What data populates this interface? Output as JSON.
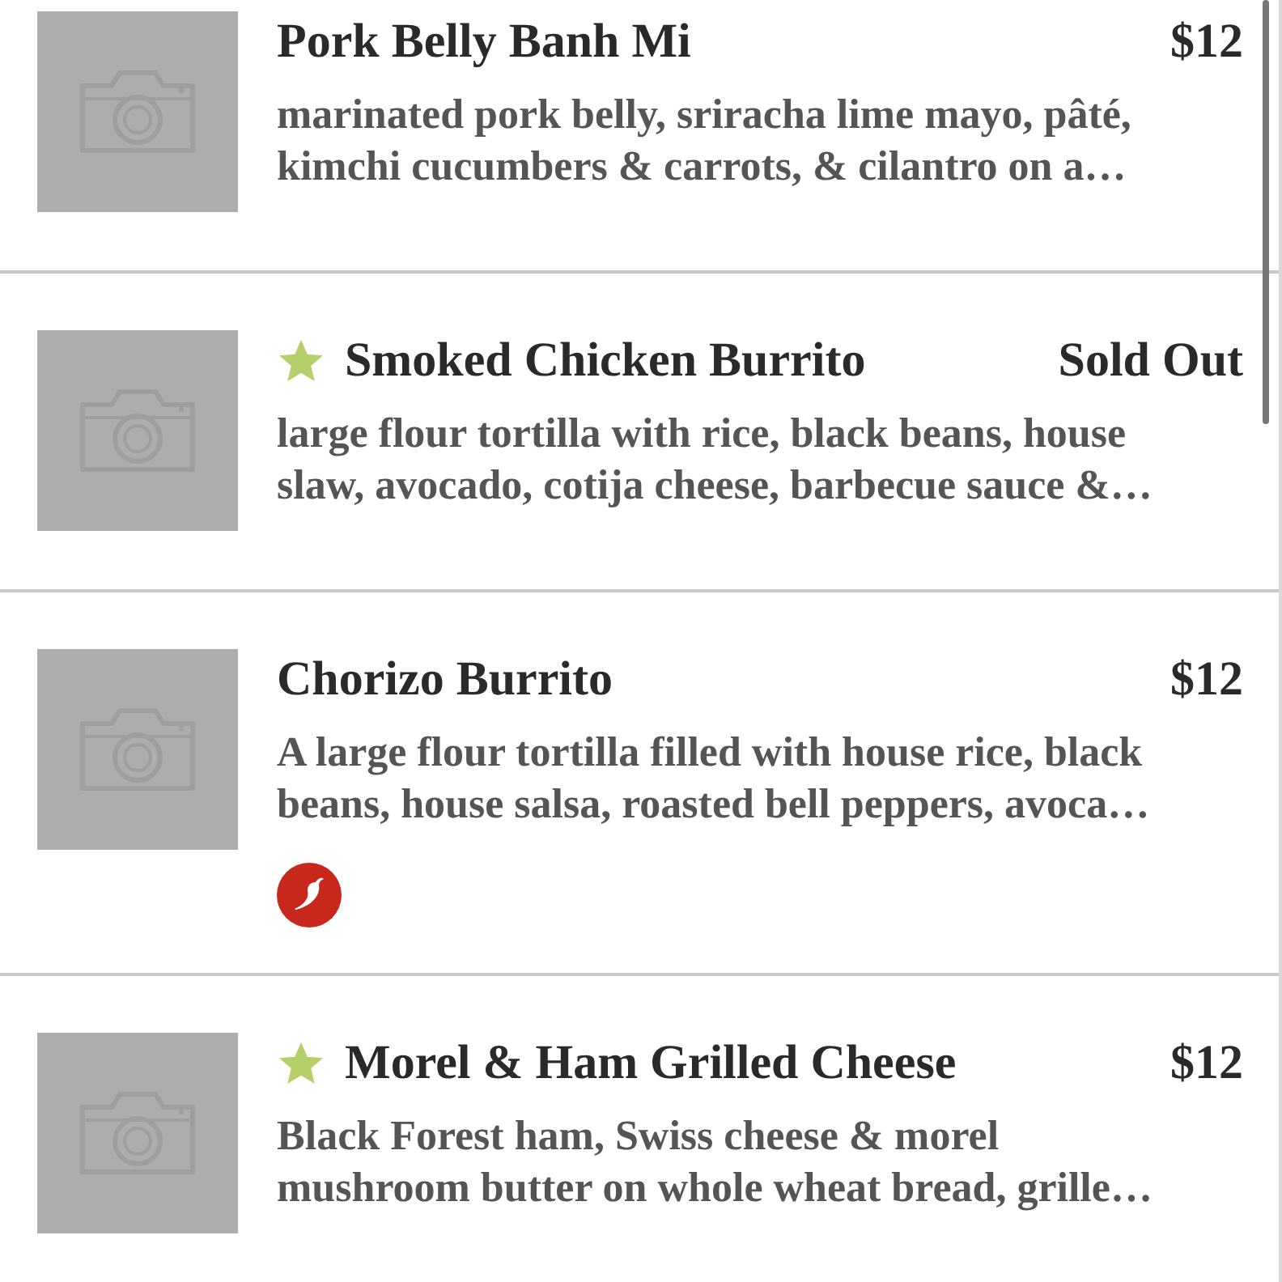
{
  "menu_items": [
    {
      "name": "Pork Belly Banh Mi",
      "featured": false,
      "price": "$12",
      "description": "marinated pork belly, sriracha lime mayo, pâté, kimchi cucumbers & carrots, & cilantro on a…",
      "spicy": false
    },
    {
      "name": "Smoked Chicken Burrito",
      "featured": true,
      "price": "Sold Out",
      "description": "large flour tortilla with rice, black beans, house slaw, avocado, cotija cheese, barbecue sauce &…",
      "spicy": false
    },
    {
      "name": "Chorizo Burrito",
      "featured": false,
      "price": "$12",
      "description": "A large flour tortilla filled with house rice, black beans, house salsa, roasted bell peppers, avoca…",
      "spicy": true
    },
    {
      "name": "Morel & Ham Grilled Cheese",
      "featured": true,
      "price": "$12",
      "description": "Black Forest ham, Swiss cheese & morel mushroom butter on whole wheat bread, grille…",
      "spicy": false
    }
  ]
}
